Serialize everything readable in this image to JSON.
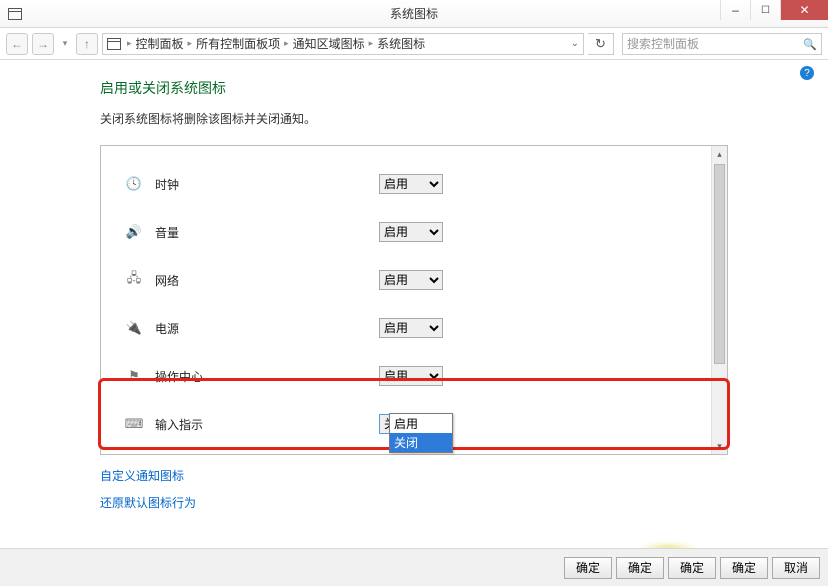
{
  "window": {
    "title": "系统图标",
    "min": "最小化",
    "max": "最大化",
    "close": "关闭"
  },
  "breadcrumb": {
    "items": [
      "控制面板",
      "所有控制面板项",
      "通知区域图标",
      "系统图标"
    ]
  },
  "search": {
    "placeholder": "搜索控制面板"
  },
  "page": {
    "heading": "启用或关闭系统图标",
    "subtitle": "关闭系统图标将删除该图标并关闭通知。"
  },
  "options": {
    "on": "启用",
    "off": "关闭"
  },
  "items": [
    {
      "icon": "clock-icon",
      "glyph": "🕓",
      "label": "时钟",
      "value": "on"
    },
    {
      "icon": "volume-icon",
      "glyph": "🔊",
      "label": "音量",
      "value": "on"
    },
    {
      "icon": "network-icon",
      "glyph": "🖧",
      "label": "网络",
      "value": "on"
    },
    {
      "icon": "power-icon",
      "glyph": "🔌",
      "label": "电源",
      "value": "on"
    },
    {
      "icon": "flag-icon",
      "glyph": "⚑",
      "label": "操作中心",
      "value": "on"
    },
    {
      "icon": "ime-icon",
      "glyph": "⌨",
      "label": "输入指示",
      "value": "off"
    }
  ],
  "dropdown_open": {
    "selected": "关闭",
    "options": [
      "启用",
      "关闭"
    ]
  },
  "links": {
    "customize": "自定义通知图标",
    "restore": "还原默认图标行为"
  },
  "buttons": {
    "ok": "确定",
    "ok2": "确定",
    "ok3": "确定",
    "ok_cancel": "确定",
    "cancel": "取消"
  }
}
